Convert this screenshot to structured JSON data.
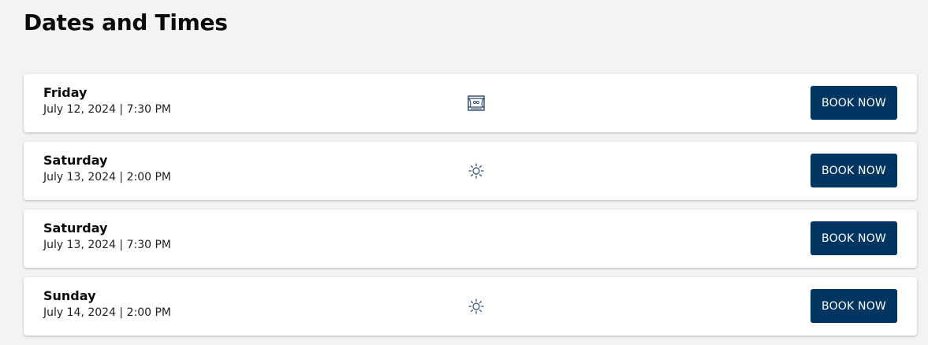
{
  "page": {
    "title": "Dates and Times"
  },
  "dates": [
    {
      "day": "Friday",
      "datetime": "July 12, 2024 | 7:30 PM",
      "icon": "theater-icon",
      "button_label": "BOOK NOW"
    },
    {
      "day": "Saturday",
      "datetime": "July 13, 2024 | 2:00 PM",
      "icon": "sun-icon",
      "button_label": "BOOK NOW"
    },
    {
      "day": "Saturday",
      "datetime": "July 13, 2024 | 7:30 PM",
      "icon": "",
      "button_label": "BOOK NOW"
    },
    {
      "day": "Sunday",
      "datetime": "July 14, 2024 | 2:00 PM",
      "icon": "sun-icon",
      "button_label": "BOOK NOW"
    }
  ],
  "colors": {
    "button_bg": "#003461",
    "button_text": "#ffffff",
    "icon_color": "#2b4b73",
    "page_bg": "#f3f3f3",
    "card_bg": "#ffffff"
  }
}
